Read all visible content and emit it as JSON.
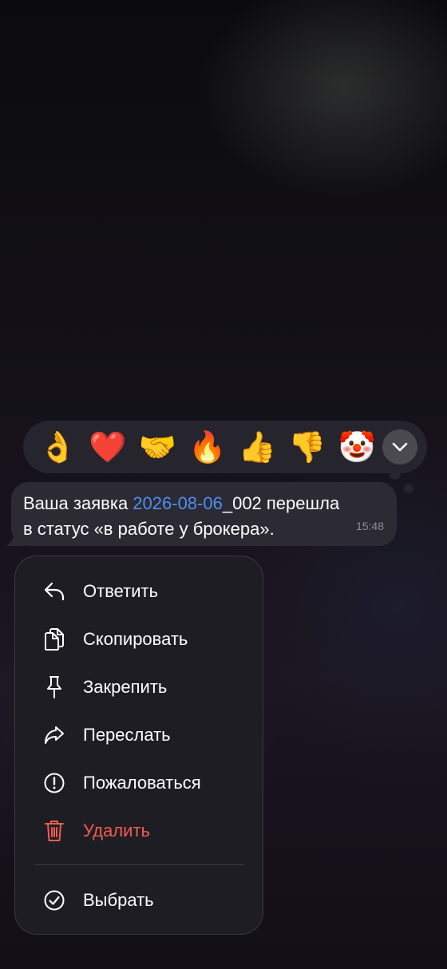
{
  "reactions": {
    "items": [
      {
        "emoji": "👌",
        "name": "ok-hand"
      },
      {
        "emoji": "❤️",
        "name": "heart"
      },
      {
        "emoji": "🤝",
        "name": "handshake"
      },
      {
        "emoji": "🔥",
        "name": "fire"
      },
      {
        "emoji": "👍",
        "name": "thumbs-up"
      },
      {
        "emoji": "👎",
        "name": "thumbs-down"
      },
      {
        "emoji": "🤡",
        "name": "clown"
      }
    ],
    "expand_icon": "chevron-down-icon"
  },
  "message": {
    "line1_before": "Ваша заявка ",
    "line1_link": "2026-08-06",
    "line1_after": "_002 перешла",
    "line2": "в статус «в работе у брокера».",
    "time": "15:48",
    "link_color": "#4f8ff5"
  },
  "menu": {
    "items": [
      {
        "label": "Ответить",
        "icon": "reply-icon"
      },
      {
        "label": "Скопировать",
        "icon": "copy-icon"
      },
      {
        "label": "Закрепить",
        "icon": "pin-icon"
      },
      {
        "label": "Переслать",
        "icon": "forward-icon"
      },
      {
        "label": "Пожаловаться",
        "icon": "report-icon"
      },
      {
        "label": "Удалить",
        "icon": "trash-icon",
        "danger": true
      },
      {
        "label": "Выбрать",
        "icon": "select-check-icon"
      }
    ],
    "danger_color": "#ef5d50"
  }
}
